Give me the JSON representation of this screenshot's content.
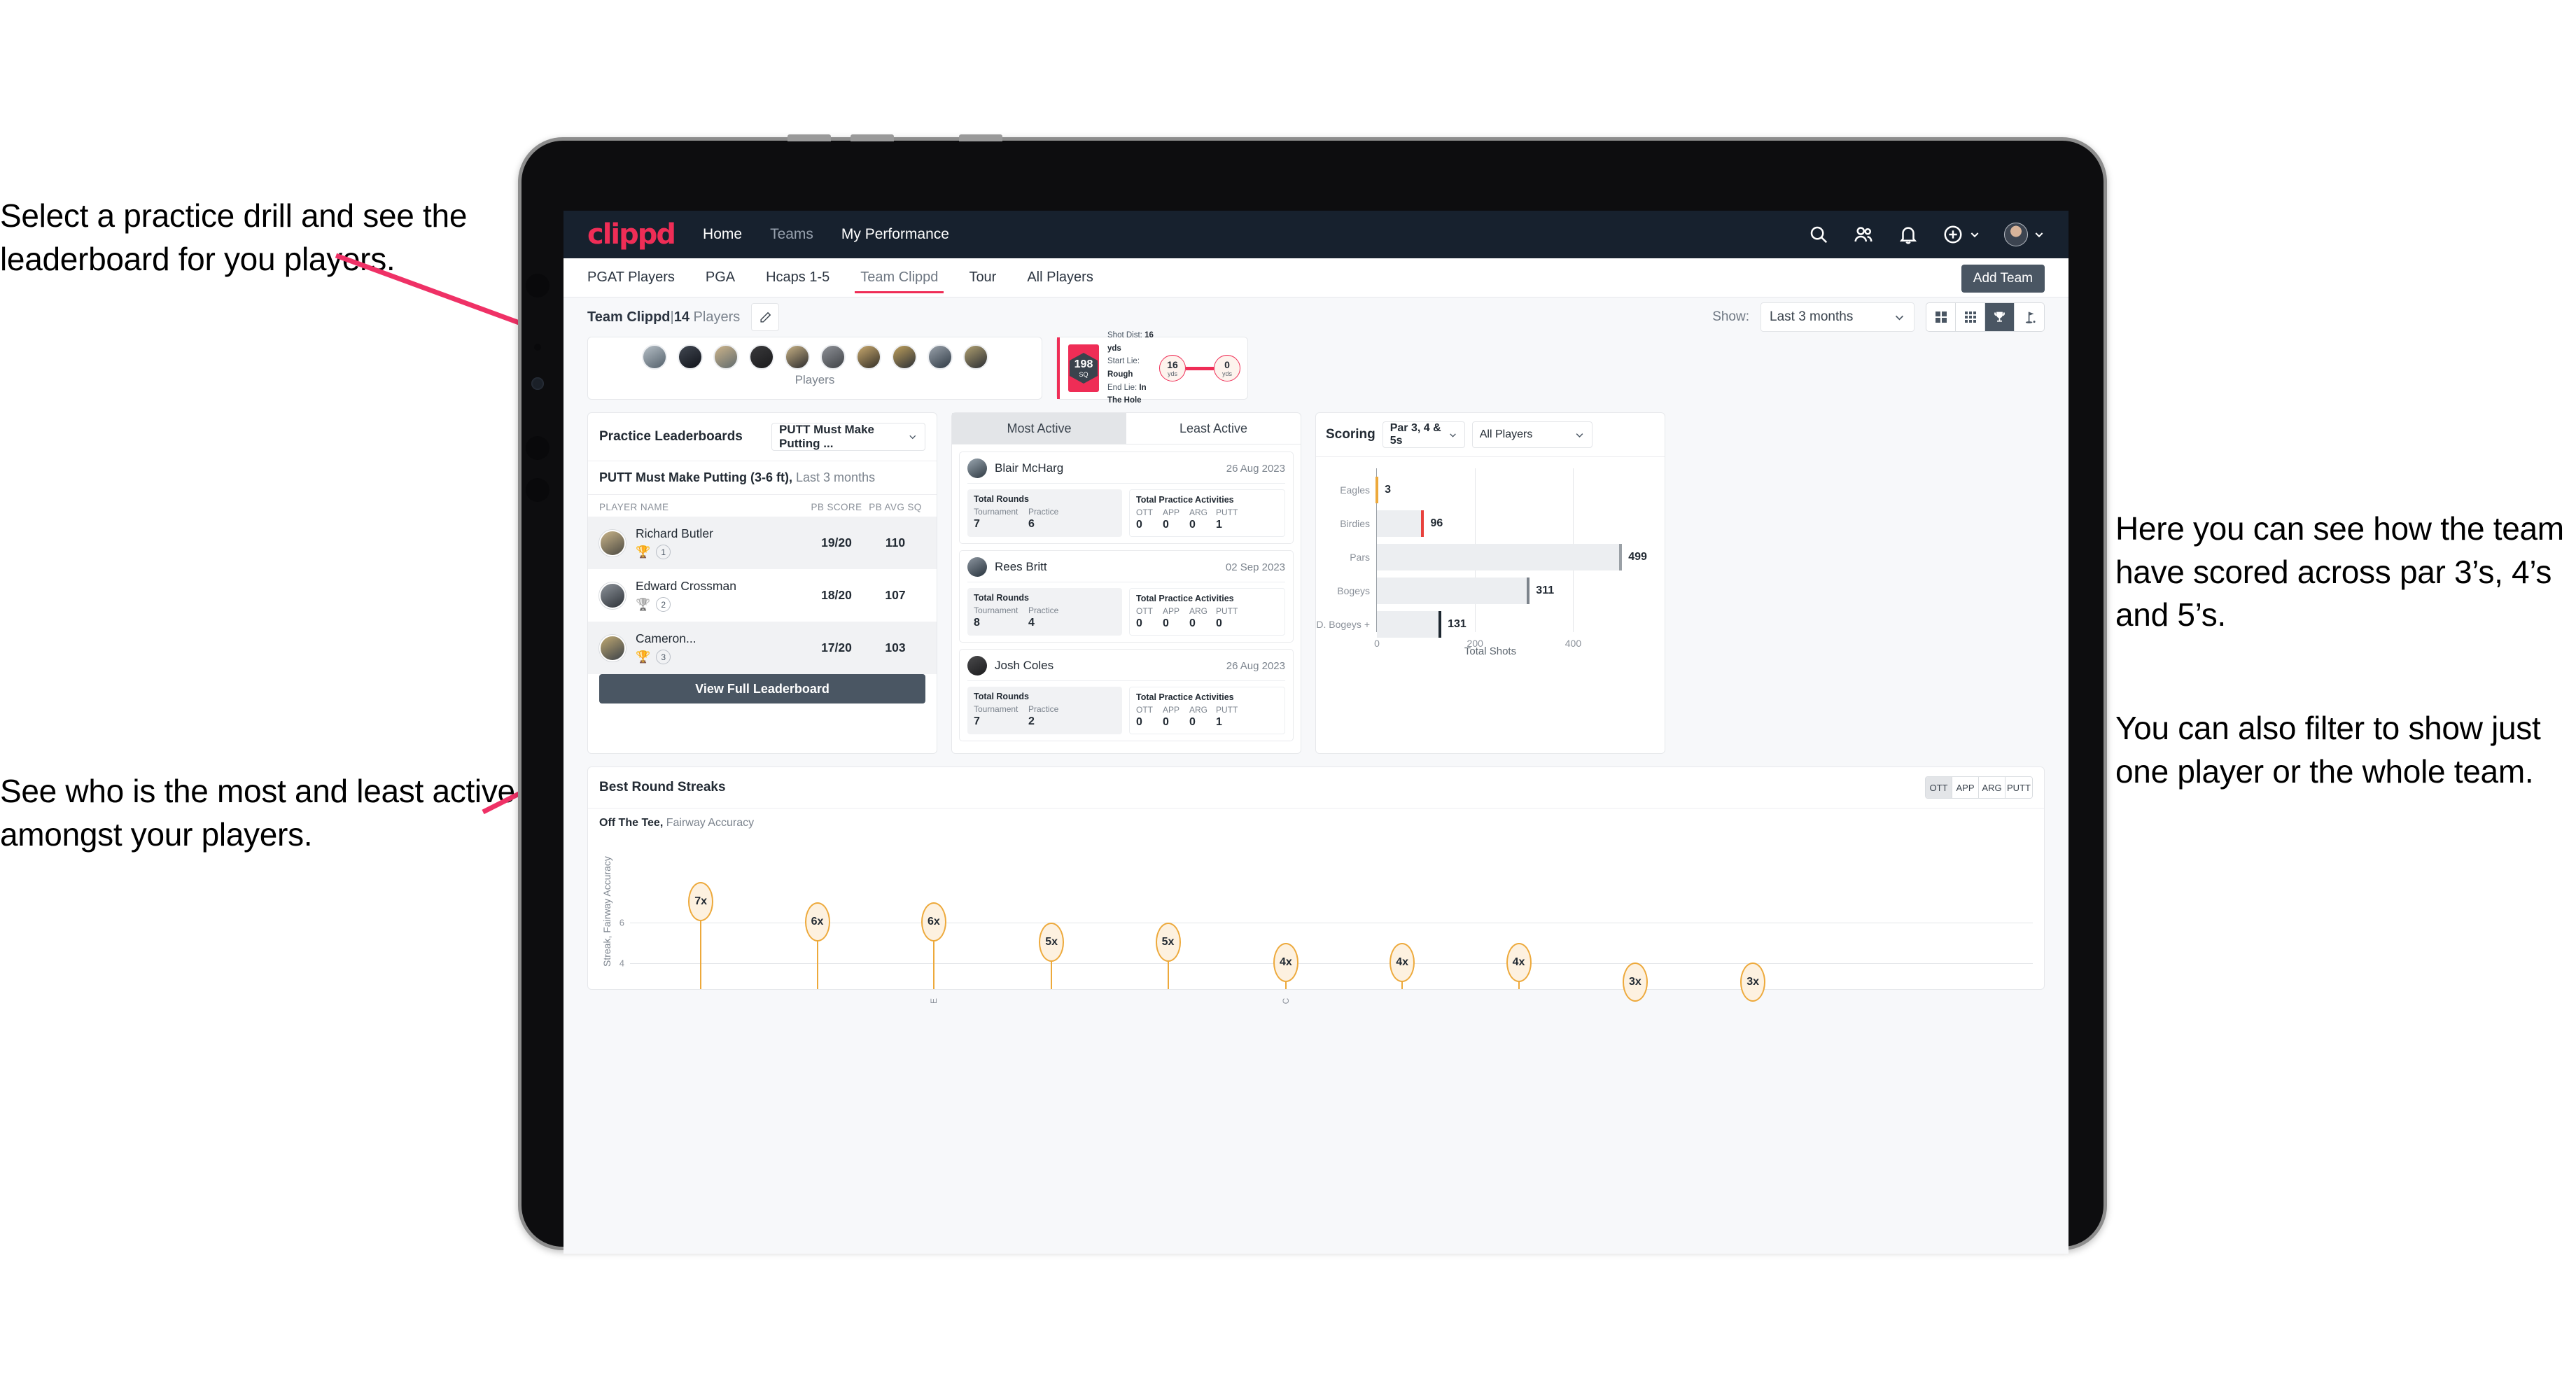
{
  "annotations": {
    "left_top": "Select a practice drill and see the leaderboard for you players.",
    "left_bottom": "See who is the most and least active amongst your players.",
    "right_top": "Here you can see how the team have scored across par 3’s, 4’s and 5’s.",
    "right_bottom": "You can also filter to show just one player or the whole team."
  },
  "colors": {
    "brand": "#ef2d56",
    "dark": "#17212e",
    "slate": "#4a5663",
    "gold": "#eda93b"
  },
  "appbar": {
    "logo": "clippd",
    "nav": [
      {
        "label": "Home",
        "state": "active"
      },
      {
        "label": "Teams",
        "state": "dim"
      },
      {
        "label": "My Performance",
        "state": "active"
      }
    ],
    "icons": [
      "search-icon",
      "people-icon",
      "bell-icon",
      "plus-circle-icon",
      "avatar"
    ]
  },
  "tabs": {
    "items": [
      {
        "label": "PGAT Players",
        "selected": false
      },
      {
        "label": "PGA",
        "selected": false
      },
      {
        "label": "Hcaps 1-5",
        "selected": false
      },
      {
        "label": "Team Clippd",
        "selected": true
      },
      {
        "label": "Tour",
        "selected": false
      },
      {
        "label": "All Players",
        "selected": false
      }
    ],
    "add_team_label": "Add Team"
  },
  "subheader": {
    "team_name": "Team Clippd",
    "separator": "|",
    "player_count": "14",
    "players_word": "Players",
    "edit_icon": "pencil-icon",
    "show_label": "Show:",
    "show_value": "Last 3 months",
    "view_toggles": [
      {
        "name": "grid-large-icon",
        "on": false
      },
      {
        "name": "grid-small-icon",
        "on": false
      },
      {
        "name": "trophy-icon",
        "on": true
      },
      {
        "name": "golf-flag-icon",
        "on": false
      }
    ]
  },
  "players_card": {
    "label": "Players",
    "avatar_count": 10
  },
  "shot_card": {
    "sq_value": "198",
    "sq_unit": "SQ",
    "lines": [
      {
        "key": "Shot Dist:",
        "value": "16 yds"
      },
      {
        "key": "Start Lie:",
        "value": "Rough"
      },
      {
        "key": "End Lie:",
        "value": "In The Hole"
      }
    ],
    "start_yds": "16",
    "end_yds": "0",
    "yds_unit": "yds"
  },
  "practice_leaderboard": {
    "title": "Practice Leaderboards",
    "drill_select": "PUTT Must Make Putting ...",
    "subtitle_bold": "PUTT Must Make Putting (3-6 ft),",
    "subtitle_muted": "Last 3 months",
    "columns": [
      "PLAYER NAME",
      "PB SCORE",
      "PB AVG SQ"
    ],
    "rows": [
      {
        "name": "Richard Butler",
        "rank": "1",
        "trophy": "gold",
        "pb_score": "19/20",
        "pb_avg_sq": "110"
      },
      {
        "name": "Edward Crossman",
        "rank": "2",
        "trophy": "silver",
        "pb_score": "18/20",
        "pb_avg_sq": "107"
      },
      {
        "name": "Cameron...",
        "rank": "3",
        "trophy": "bronze",
        "pb_score": "17/20",
        "pb_avg_sq": "103"
      }
    ],
    "button_label": "View Full Leaderboard"
  },
  "activity": {
    "tabs": [
      {
        "label": "Most Active",
        "selected": true
      },
      {
        "label": "Least Active",
        "selected": false
      }
    ],
    "rounds_title": "Total Rounds",
    "rounds_keys": [
      "Tournament",
      "Practice"
    ],
    "practice_title": "Total Practice Activities",
    "practice_keys": [
      "OTT",
      "APP",
      "ARG",
      "PUTT"
    ],
    "items": [
      {
        "name": "Blair McHarg",
        "date": "26 Aug 2023",
        "rounds": [
          "7",
          "6"
        ],
        "practice": [
          "0",
          "0",
          "0",
          "1"
        ]
      },
      {
        "name": "Rees Britt",
        "date": "02 Sep 2023",
        "rounds": [
          "8",
          "4"
        ],
        "practice": [
          "0",
          "0",
          "0",
          "0"
        ]
      },
      {
        "name": "Josh Coles",
        "date": "26 Aug 2023",
        "rounds": [
          "7",
          "2"
        ],
        "practice": [
          "0",
          "0",
          "0",
          "1"
        ]
      }
    ]
  },
  "scoring": {
    "title": "Scoring",
    "par_select": "Par 3, 4 & 5s",
    "player_select": "All Players",
    "chart_data": {
      "type": "bar",
      "orientation": "horizontal",
      "title": "Scoring",
      "categories": [
        "Eagles",
        "Birdies",
        "Pars",
        "Bogeys",
        "D. Bogeys +"
      ],
      "values": [
        3,
        96,
        499,
        311,
        131
      ],
      "cap_colors": [
        "#eda93b",
        "#e8413c",
        "#9aa0a6",
        "#7c838b",
        "#1d2730"
      ],
      "xlabel": "Total Shots",
      "ylabel": "",
      "xticks": [
        0,
        200,
        400
      ],
      "xlim": [
        0,
        540
      ],
      "grid": true,
      "legend": "none"
    }
  },
  "streaks": {
    "title": "Best Round Streaks",
    "segments": [
      {
        "label": "OTT",
        "selected": true
      },
      {
        "label": "APP",
        "selected": false
      },
      {
        "label": "ARG",
        "selected": false
      },
      {
        "label": "PUTT",
        "selected": false
      }
    ],
    "sub_bold": "Off The Tee,",
    "sub_muted": "Fairway Accuracy",
    "y_axis_label": "Streak, Fairway Accuracy",
    "chart_data": {
      "type": "bar",
      "title": "Off The Tee, Fairway Accuracy",
      "ylabel": "Streak, Fairway Accuracy",
      "xlabel": "",
      "categories": [
        "",
        "",
        "",
        "",
        "",
        "",
        "",
        "",
        "",
        ""
      ],
      "labels": [
        "7x",
        "6x",
        "6x",
        "5x",
        "5x",
        "4x",
        "4x",
        "4x",
        "3x",
        "3x"
      ],
      "values": [
        7,
        6,
        6,
        5,
        5,
        4,
        4,
        4,
        3,
        3
      ],
      "yticks": [
        4,
        6
      ],
      "ylim": [
        0,
        8
      ],
      "grid": true,
      "marker": "lollipop-ellipse"
    }
  }
}
